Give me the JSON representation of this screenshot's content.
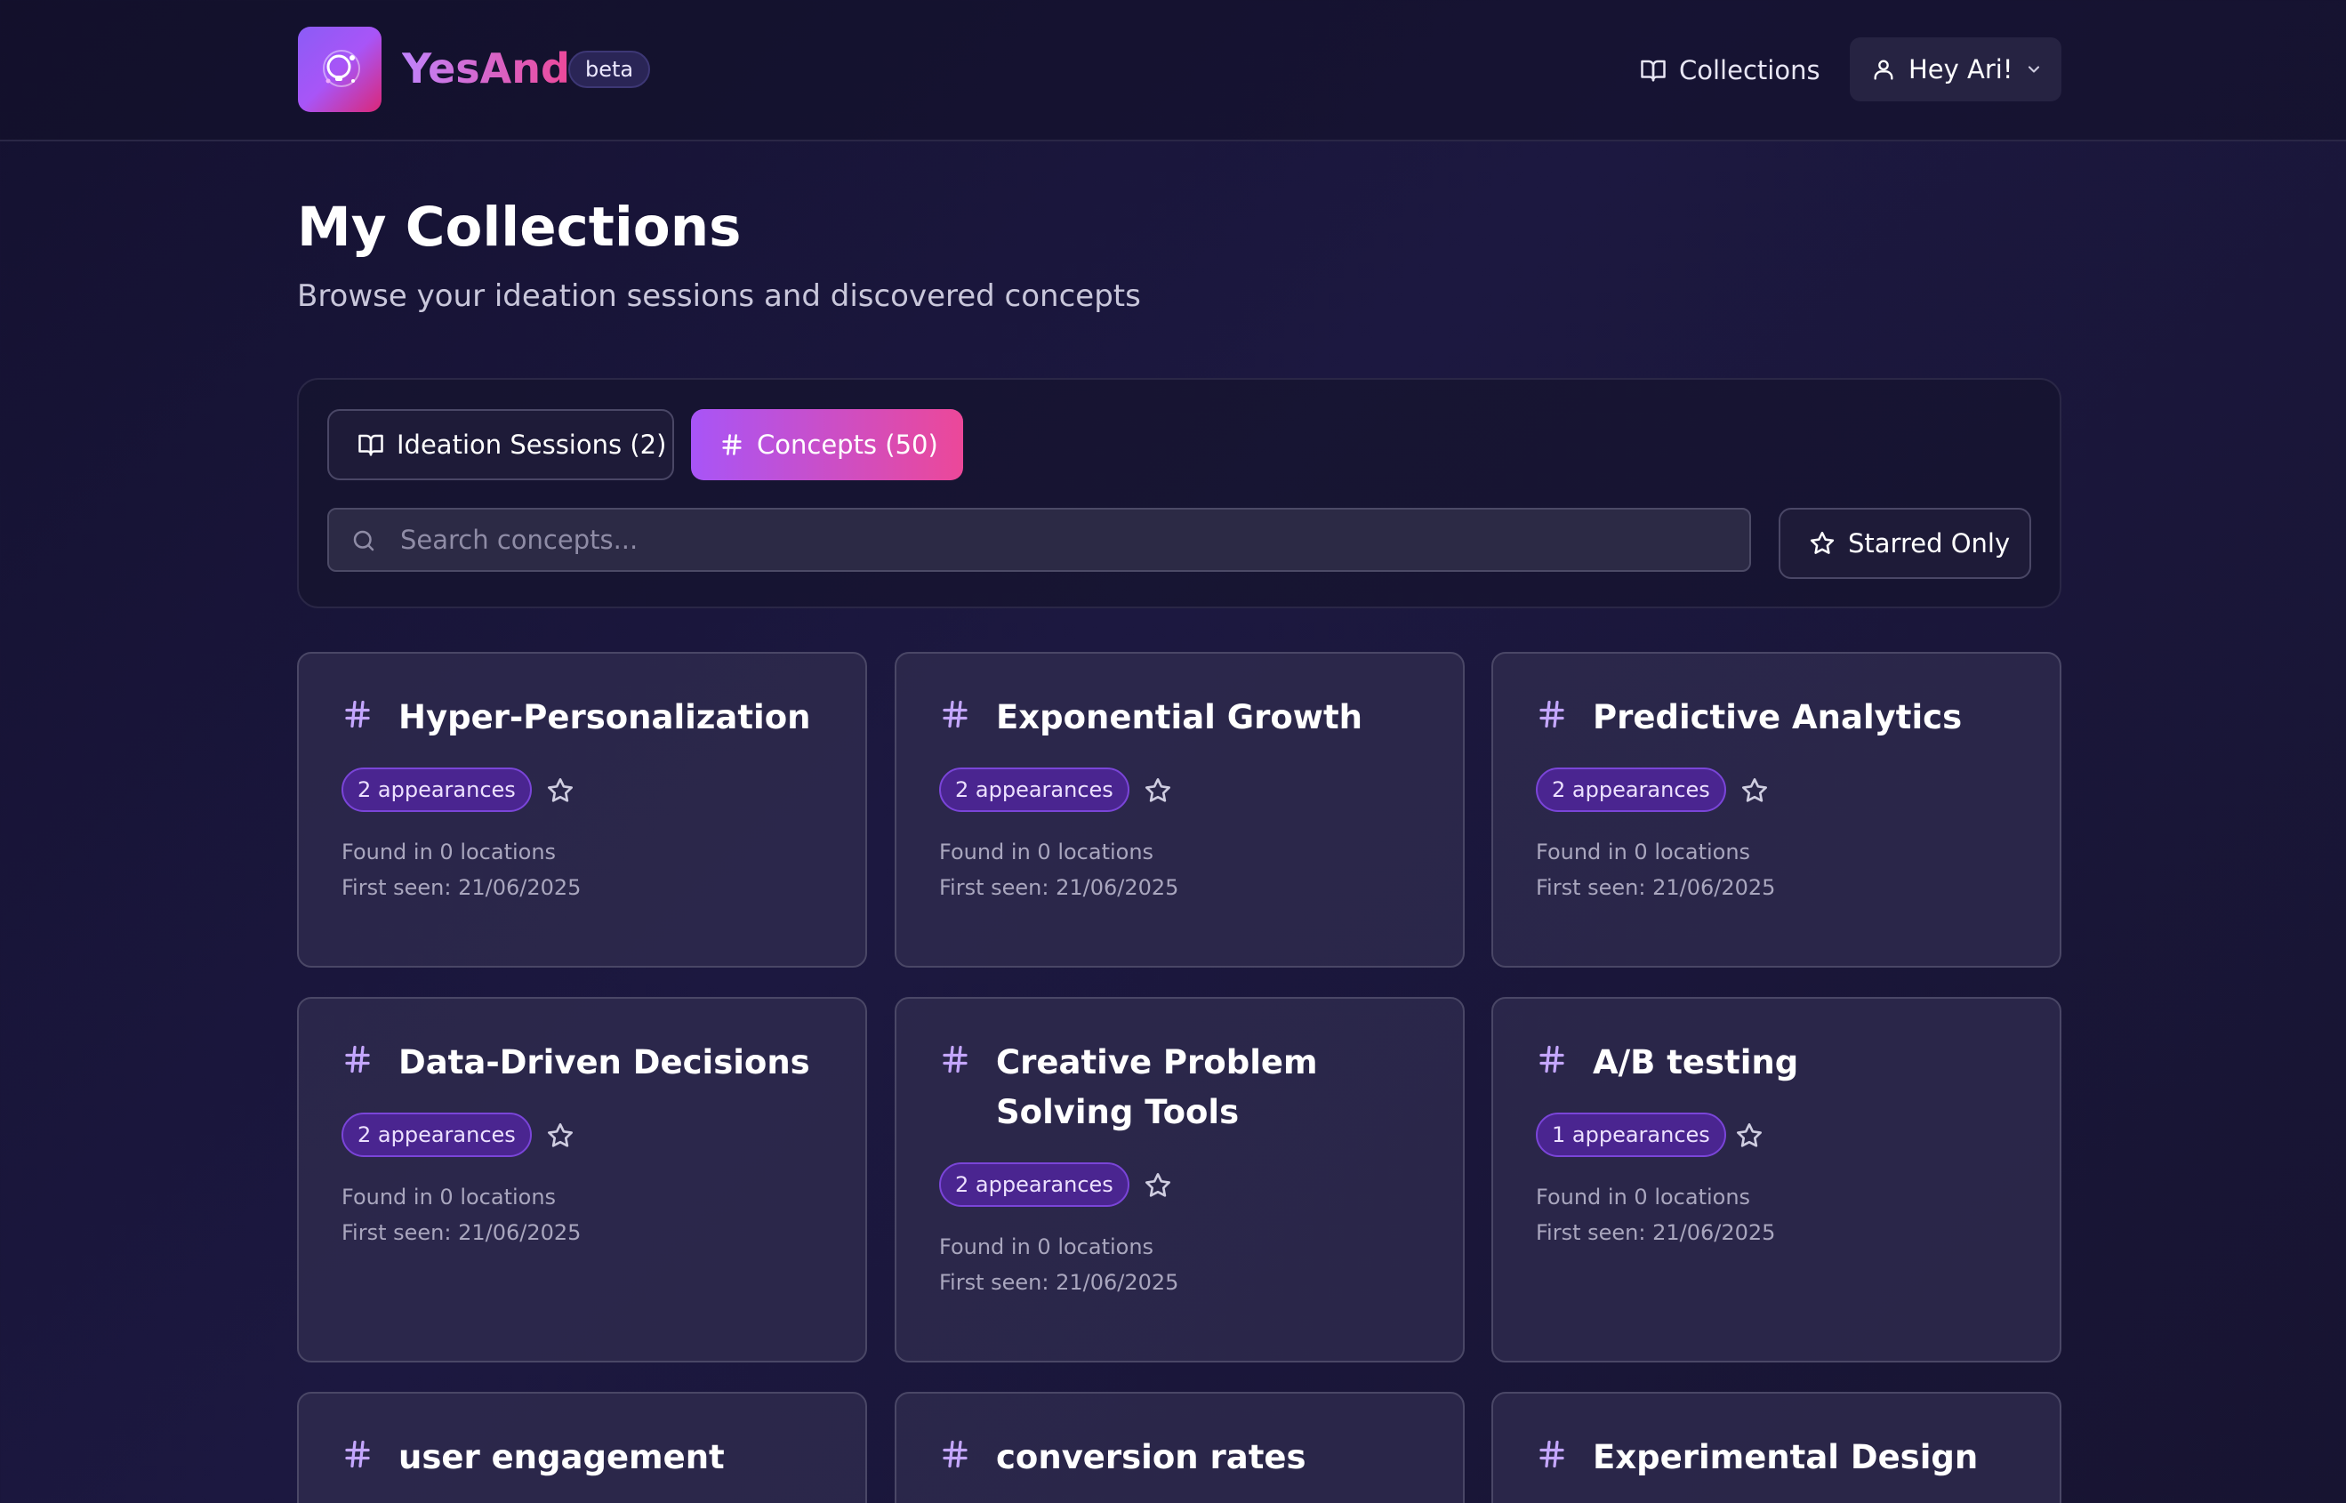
{
  "header": {
    "brand": "YesAnd",
    "badge": "beta",
    "nav_collections": "Collections",
    "user_greeting": "Hey Ari!"
  },
  "page": {
    "title": "My Collections",
    "subtitle": "Browse your ideation sessions and discovered concepts"
  },
  "tabs": {
    "sessions": "Ideation Sessions (2)",
    "concepts": "Concepts (50)"
  },
  "search": {
    "placeholder": "Search concepts..."
  },
  "starred_button": "Starred Only",
  "cards": [
    {
      "title": "Hyper-Personalization",
      "appearances": "2 appearances",
      "locations": "Found in 0 locations",
      "first_seen": "First seen: 21/06/2025"
    },
    {
      "title": "Exponential Growth",
      "appearances": "2 appearances",
      "locations": "Found in 0 locations",
      "first_seen": "First seen: 21/06/2025"
    },
    {
      "title": "Predictive Analytics",
      "appearances": "2 appearances",
      "locations": "Found in 0 locations",
      "first_seen": "First seen: 21/06/2025"
    },
    {
      "title": "Data-Driven Decisions",
      "appearances": "2 appearances",
      "locations": "Found in 0 locations",
      "first_seen": "First seen: 21/06/2025"
    },
    {
      "title": "Creative Problem Solving Tools",
      "appearances": "2 appearances",
      "locations": "Found in 0 locations",
      "first_seen": "First seen: 21/06/2025"
    },
    {
      "title": "A/B testing",
      "appearances": "1 appearances",
      "locations": "Found in 0 locations",
      "first_seen": "First seen: 21/06/2025"
    },
    {
      "title": "user engagement"
    },
    {
      "title": "conversion rates"
    },
    {
      "title": "Experimental Design"
    }
  ],
  "icons": {
    "logo": "lightbulb-logo-icon",
    "collections": "book-open-icon",
    "user": "user-icon",
    "dropdown": "chevron-down-icon",
    "concepts": "hash-icon",
    "search": "search-icon",
    "star": "star-icon"
  },
  "colors": {
    "accent_gradient_start": "#a855f7",
    "accent_gradient_end": "#ec4899",
    "badge_bg": "#4a2590",
    "hash_color": "#c4a6ff"
  }
}
